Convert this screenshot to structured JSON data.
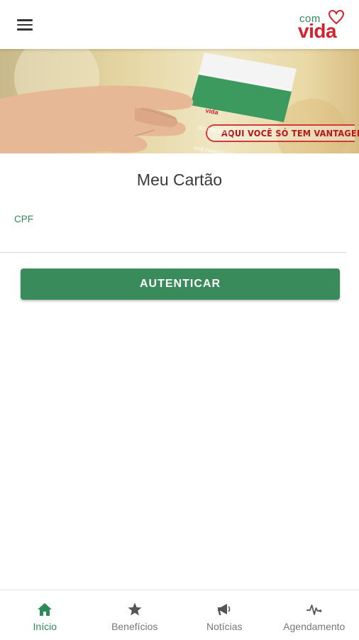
{
  "header": {
    "menu_icon": "hamburger-menu-icon",
    "logo": {
      "text_small": "com",
      "text_big": "vida"
    }
  },
  "banner": {
    "card": {
      "logo_text": "vida",
      "number": "023.586.025-60",
      "name": "JOSÉ FRANCISCO DA SILVA"
    },
    "slogan": "AQUI VOCÊ SÓ TEM VANTAGEM"
  },
  "main": {
    "title": "Meu Cartão",
    "cpf_label": "CPF",
    "cpf_value": "",
    "authenticate_label": "AUTENTICAR"
  },
  "bottom_nav": {
    "items": [
      {
        "label": "Início",
        "icon": "home-icon",
        "active": true
      },
      {
        "label": "Benefícios",
        "icon": "star-icon",
        "active": false
      },
      {
        "label": "Notícias",
        "icon": "megaphone-icon",
        "active": false
      },
      {
        "label": "Agendamento",
        "icon": "heartbeat-icon",
        "active": false
      }
    ]
  },
  "colors": {
    "brand_green": "#2e8b57",
    "button_green": "#3a8b5c",
    "brand_red": "#d6202e",
    "inactive_gray": "#777777"
  }
}
